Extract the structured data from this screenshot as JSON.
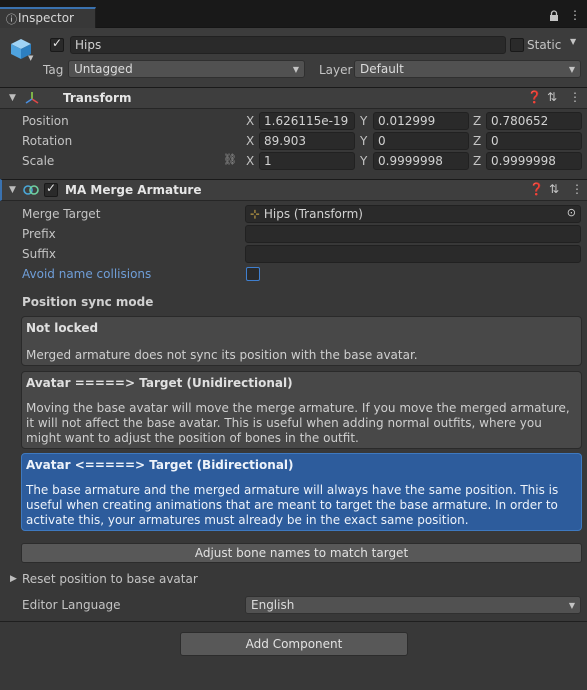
{
  "tab": {
    "label": "Inspector"
  },
  "header": {
    "object_name": "Hips",
    "static_label": "Static",
    "tag_label": "Tag",
    "tag_value": "Untagged",
    "layer_label": "Layer",
    "layer_value": "Default"
  },
  "transform": {
    "title": "Transform",
    "rows": [
      {
        "label": "Position",
        "x": "1.626115e-19",
        "y": "0.012999",
        "z": "0.780652"
      },
      {
        "label": "Rotation",
        "x": "89.903",
        "y": "0",
        "z": "0"
      },
      {
        "label": "Scale",
        "x": "1",
        "y": "0.9999998",
        "z": "0.9999998"
      }
    ],
    "axis_x": "X",
    "axis_y": "Y",
    "axis_z": "Z"
  },
  "merge": {
    "title": "MA Merge Armature",
    "merge_target_label": "Merge Target",
    "merge_target_value": "Hips (Transform)",
    "prefix_label": "Prefix",
    "prefix_value": "",
    "suffix_label": "Suffix",
    "suffix_value": "",
    "avoid_label": "Avoid name collisions",
    "sync_mode_label": "Position sync mode",
    "options": [
      {
        "title": "Not locked",
        "desc": "Merged armature does not sync its position with the base avatar."
      },
      {
        "title": "Avatar =====> Target (Unidirectional)",
        "desc": "Moving the base avatar will move the merge armature. If you move the merged armature, it will not affect the base avatar. This is useful when adding normal outfits, where you might want to adjust the position of bones in the outfit."
      },
      {
        "title": "Avatar <=====> Target (Bidirectional)",
        "desc": "The base armature and the merged armature will always have the same position. This is useful when creating animations that are meant to target the base armature. In order to activate this, your armatures must already be in the exact same position."
      }
    ],
    "adjust_button": "Adjust bone names to match target",
    "reset_label": "Reset position to base avatar",
    "language_label": "Editor Language",
    "language_value": "English"
  },
  "add_component": "Add Component",
  "colors": {
    "accent": "#2d5c9c",
    "tab_highlight": "#3a72b0",
    "link": "#6f9ed8"
  }
}
